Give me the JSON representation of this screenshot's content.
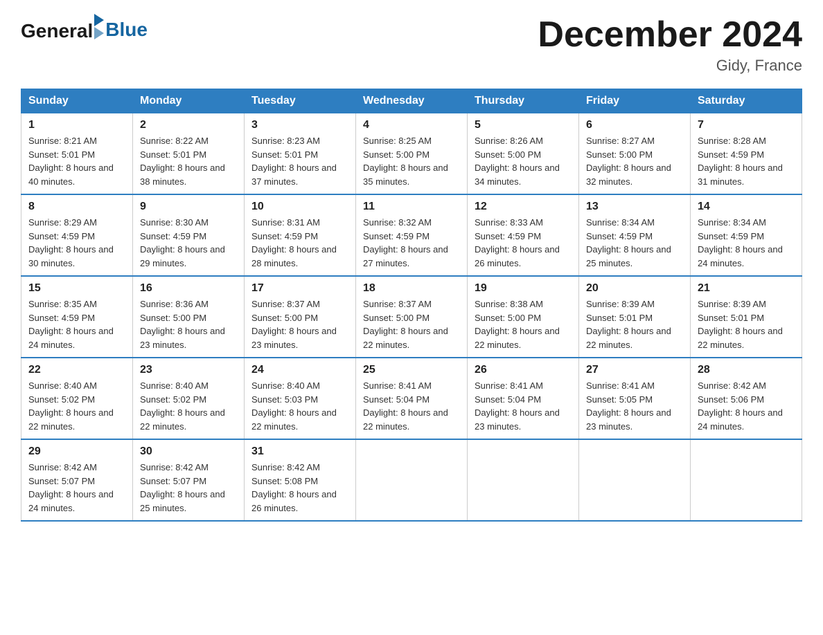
{
  "header": {
    "logo_general": "General",
    "logo_blue": "Blue",
    "title": "December 2024",
    "location": "Gidy, France"
  },
  "days_of_week": [
    "Sunday",
    "Monday",
    "Tuesday",
    "Wednesday",
    "Thursday",
    "Friday",
    "Saturday"
  ],
  "weeks": [
    [
      {
        "day": 1,
        "sunrise": "8:21 AM",
        "sunset": "5:01 PM",
        "daylight": "8 hours and 40 minutes."
      },
      {
        "day": 2,
        "sunrise": "8:22 AM",
        "sunset": "5:01 PM",
        "daylight": "8 hours and 38 minutes."
      },
      {
        "day": 3,
        "sunrise": "8:23 AM",
        "sunset": "5:01 PM",
        "daylight": "8 hours and 37 minutes."
      },
      {
        "day": 4,
        "sunrise": "8:25 AM",
        "sunset": "5:00 PM",
        "daylight": "8 hours and 35 minutes."
      },
      {
        "day": 5,
        "sunrise": "8:26 AM",
        "sunset": "5:00 PM",
        "daylight": "8 hours and 34 minutes."
      },
      {
        "day": 6,
        "sunrise": "8:27 AM",
        "sunset": "5:00 PM",
        "daylight": "8 hours and 32 minutes."
      },
      {
        "day": 7,
        "sunrise": "8:28 AM",
        "sunset": "4:59 PM",
        "daylight": "8 hours and 31 minutes."
      }
    ],
    [
      {
        "day": 8,
        "sunrise": "8:29 AM",
        "sunset": "4:59 PM",
        "daylight": "8 hours and 30 minutes."
      },
      {
        "day": 9,
        "sunrise": "8:30 AM",
        "sunset": "4:59 PM",
        "daylight": "8 hours and 29 minutes."
      },
      {
        "day": 10,
        "sunrise": "8:31 AM",
        "sunset": "4:59 PM",
        "daylight": "8 hours and 28 minutes."
      },
      {
        "day": 11,
        "sunrise": "8:32 AM",
        "sunset": "4:59 PM",
        "daylight": "8 hours and 27 minutes."
      },
      {
        "day": 12,
        "sunrise": "8:33 AM",
        "sunset": "4:59 PM",
        "daylight": "8 hours and 26 minutes."
      },
      {
        "day": 13,
        "sunrise": "8:34 AM",
        "sunset": "4:59 PM",
        "daylight": "8 hours and 25 minutes."
      },
      {
        "day": 14,
        "sunrise": "8:34 AM",
        "sunset": "4:59 PM",
        "daylight": "8 hours and 24 minutes."
      }
    ],
    [
      {
        "day": 15,
        "sunrise": "8:35 AM",
        "sunset": "4:59 PM",
        "daylight": "8 hours and 24 minutes."
      },
      {
        "day": 16,
        "sunrise": "8:36 AM",
        "sunset": "5:00 PM",
        "daylight": "8 hours and 23 minutes."
      },
      {
        "day": 17,
        "sunrise": "8:37 AM",
        "sunset": "5:00 PM",
        "daylight": "8 hours and 23 minutes."
      },
      {
        "day": 18,
        "sunrise": "8:37 AM",
        "sunset": "5:00 PM",
        "daylight": "8 hours and 22 minutes."
      },
      {
        "day": 19,
        "sunrise": "8:38 AM",
        "sunset": "5:00 PM",
        "daylight": "8 hours and 22 minutes."
      },
      {
        "day": 20,
        "sunrise": "8:39 AM",
        "sunset": "5:01 PM",
        "daylight": "8 hours and 22 minutes."
      },
      {
        "day": 21,
        "sunrise": "8:39 AM",
        "sunset": "5:01 PM",
        "daylight": "8 hours and 22 minutes."
      }
    ],
    [
      {
        "day": 22,
        "sunrise": "8:40 AM",
        "sunset": "5:02 PM",
        "daylight": "8 hours and 22 minutes."
      },
      {
        "day": 23,
        "sunrise": "8:40 AM",
        "sunset": "5:02 PM",
        "daylight": "8 hours and 22 minutes."
      },
      {
        "day": 24,
        "sunrise": "8:40 AM",
        "sunset": "5:03 PM",
        "daylight": "8 hours and 22 minutes."
      },
      {
        "day": 25,
        "sunrise": "8:41 AM",
        "sunset": "5:04 PM",
        "daylight": "8 hours and 22 minutes."
      },
      {
        "day": 26,
        "sunrise": "8:41 AM",
        "sunset": "5:04 PM",
        "daylight": "8 hours and 23 minutes."
      },
      {
        "day": 27,
        "sunrise": "8:41 AM",
        "sunset": "5:05 PM",
        "daylight": "8 hours and 23 minutes."
      },
      {
        "day": 28,
        "sunrise": "8:42 AM",
        "sunset": "5:06 PM",
        "daylight": "8 hours and 24 minutes."
      }
    ],
    [
      {
        "day": 29,
        "sunrise": "8:42 AM",
        "sunset": "5:07 PM",
        "daylight": "8 hours and 24 minutes."
      },
      {
        "day": 30,
        "sunrise": "8:42 AM",
        "sunset": "5:07 PM",
        "daylight": "8 hours and 25 minutes."
      },
      {
        "day": 31,
        "sunrise": "8:42 AM",
        "sunset": "5:08 PM",
        "daylight": "8 hours and 26 minutes."
      },
      null,
      null,
      null,
      null
    ]
  ]
}
